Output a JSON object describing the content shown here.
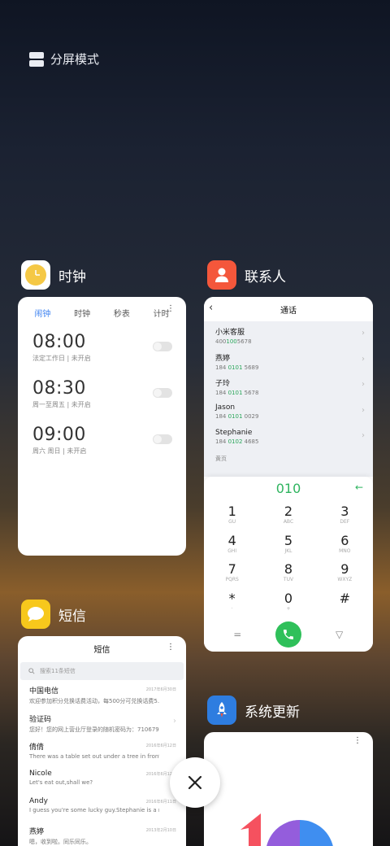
{
  "split_mode": {
    "label": "分屏模式"
  },
  "close_icon": "close-icon",
  "cards": {
    "clock": {
      "app_name": "时钟",
      "icon": "clock-icon",
      "tabs": [
        "闹钟",
        "时钟",
        "秒表",
        "计时"
      ],
      "active_tab": "闹钟",
      "alarms": [
        {
          "time": "08:00",
          "sub": "法定工作日 | 未开启"
        },
        {
          "time": "08:30",
          "sub": "周一至周五 | 未开启"
        },
        {
          "time": "09:00",
          "sub": "周六 周日 | 未开启"
        }
      ]
    },
    "contacts": {
      "app_name": "联系人",
      "icon": "contacts-icon",
      "title": "通话",
      "list": [
        {
          "name": "小米客服",
          "num_pre": "400",
          "num_hl": "100",
          "num_post": "5678"
        },
        {
          "name": "燕婷",
          "num_pre": "184 ",
          "num_hl": "0101",
          "num_post": " 5689"
        },
        {
          "name": "子玲",
          "num_pre": "184 ",
          "num_hl": "0101",
          "num_post": " 5678"
        },
        {
          "name": "Jason",
          "num_pre": "184 ",
          "num_hl": "0101",
          "num_post": " 0029"
        },
        {
          "name": "Stephanie",
          "num_pre": "184 ",
          "num_hl": "0102",
          "num_post": " 4685"
        }
      ],
      "section": "黄页",
      "dial_input": "010",
      "keys": [
        {
          "d": "1",
          "l": "GU"
        },
        {
          "d": "2",
          "l": "ABC"
        },
        {
          "d": "3",
          "l": "DEF"
        },
        {
          "d": "4",
          "l": "GHI"
        },
        {
          "d": "5",
          "l": "JKL"
        },
        {
          "d": "6",
          "l": "MNO"
        },
        {
          "d": "7",
          "l": "PQRS"
        },
        {
          "d": "8",
          "l": "TUV"
        },
        {
          "d": "9",
          "l": "WXYZ"
        },
        {
          "d": "*",
          "l": "·"
        },
        {
          "d": "0",
          "l": "+"
        },
        {
          "d": "#",
          "l": ""
        }
      ],
      "bottom": {
        "left": "=",
        "right": "▽"
      }
    },
    "sms": {
      "app_name": "短信",
      "icon": "sms-icon",
      "title": "短信",
      "search_placeholder": "搜索11条短信",
      "messages": [
        {
          "name": "中国电信",
          "preview": "欢迎参加积分兑换话费活动，每500分可兑换话费5...",
          "date": "2017年6月30日"
        },
        {
          "name": "验证码",
          "preview": "您好！您的网上营业厅登录的随机密码为：710679...",
          "date": ""
        },
        {
          "name": "倩倩",
          "preview": "There was a table set out under a tree in front of...",
          "date": "2016年6月12日"
        },
        {
          "name": "Nicole",
          "preview": "Let's eat out,shall we?",
          "date": "2016年6月12日"
        },
        {
          "name": "Andy",
          "preview": "I guess you're some lucky guy.Stephanie is a ni...",
          "date": "2016年6月11日"
        },
        {
          "name": "燕婷",
          "preview": "嗯，收到啦。同乐同乐。",
          "date": "2013年2月10日"
        }
      ]
    },
    "update": {
      "app_name": "系统更新",
      "icon": "rocket-icon"
    }
  },
  "colors": {
    "clock_icon": "#f5c845",
    "contacts_icon": "#f4573b",
    "sms_icon": "#f7c81c",
    "update_icon": "#2e7de0",
    "accent_blue": "#3d82f0",
    "dial_green": "#2fc05a"
  }
}
